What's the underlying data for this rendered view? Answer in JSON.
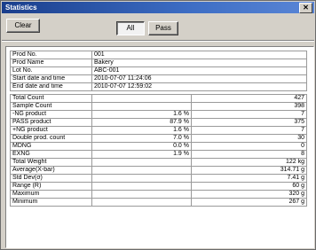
{
  "window": {
    "title": "Statistics",
    "close_glyph": "✕"
  },
  "toolbar": {
    "clear_label": "Clear",
    "all_label": "All",
    "pass_label": "Pass"
  },
  "info_rows": [
    {
      "label": "Prod No.",
      "value": "001"
    },
    {
      "label": "Prod Name",
      "value": "Bakery"
    },
    {
      "label": "Lot No.",
      "value": "ABC-001"
    },
    {
      "label": "Start date and time",
      "value": "2010-07-07 11:24:06"
    },
    {
      "label": "End date and time",
      "value": "2010-07-07 12:59:02"
    }
  ],
  "stat_rows": [
    {
      "label": "Total Count",
      "pct": "",
      "value": "427"
    },
    {
      "label": "Sample Count",
      "pct": "",
      "value": "398"
    },
    {
      "label": "-NG product",
      "pct": "1.6 %",
      "value": "7"
    },
    {
      "label": "PASS product",
      "pct": "87.9 %",
      "value": "375"
    },
    {
      "label": "+NG product",
      "pct": "1.6 %",
      "value": "7"
    },
    {
      "label": "Double prod. count",
      "pct": "7.0 %",
      "value": "30"
    },
    {
      "label": "MDNG",
      "pct": "0.0 %",
      "value": "0"
    },
    {
      "label": "EXNG",
      "pct": "1.9 %",
      "value": "8"
    },
    {
      "label": "Total Weight",
      "pct": "",
      "value": "122 kg"
    },
    {
      "label": "Average(X-bar)",
      "pct": "",
      "value": "314.71 g"
    },
    {
      "label": "Std Dev(σ)",
      "pct": "",
      "value": "7.41 g"
    },
    {
      "label": "Range (R)",
      "pct": "",
      "value": "60 g"
    },
    {
      "label": "Maximum",
      "pct": "",
      "value": "320 g"
    },
    {
      "label": "Minimum",
      "pct": "",
      "value": "267 g"
    }
  ]
}
